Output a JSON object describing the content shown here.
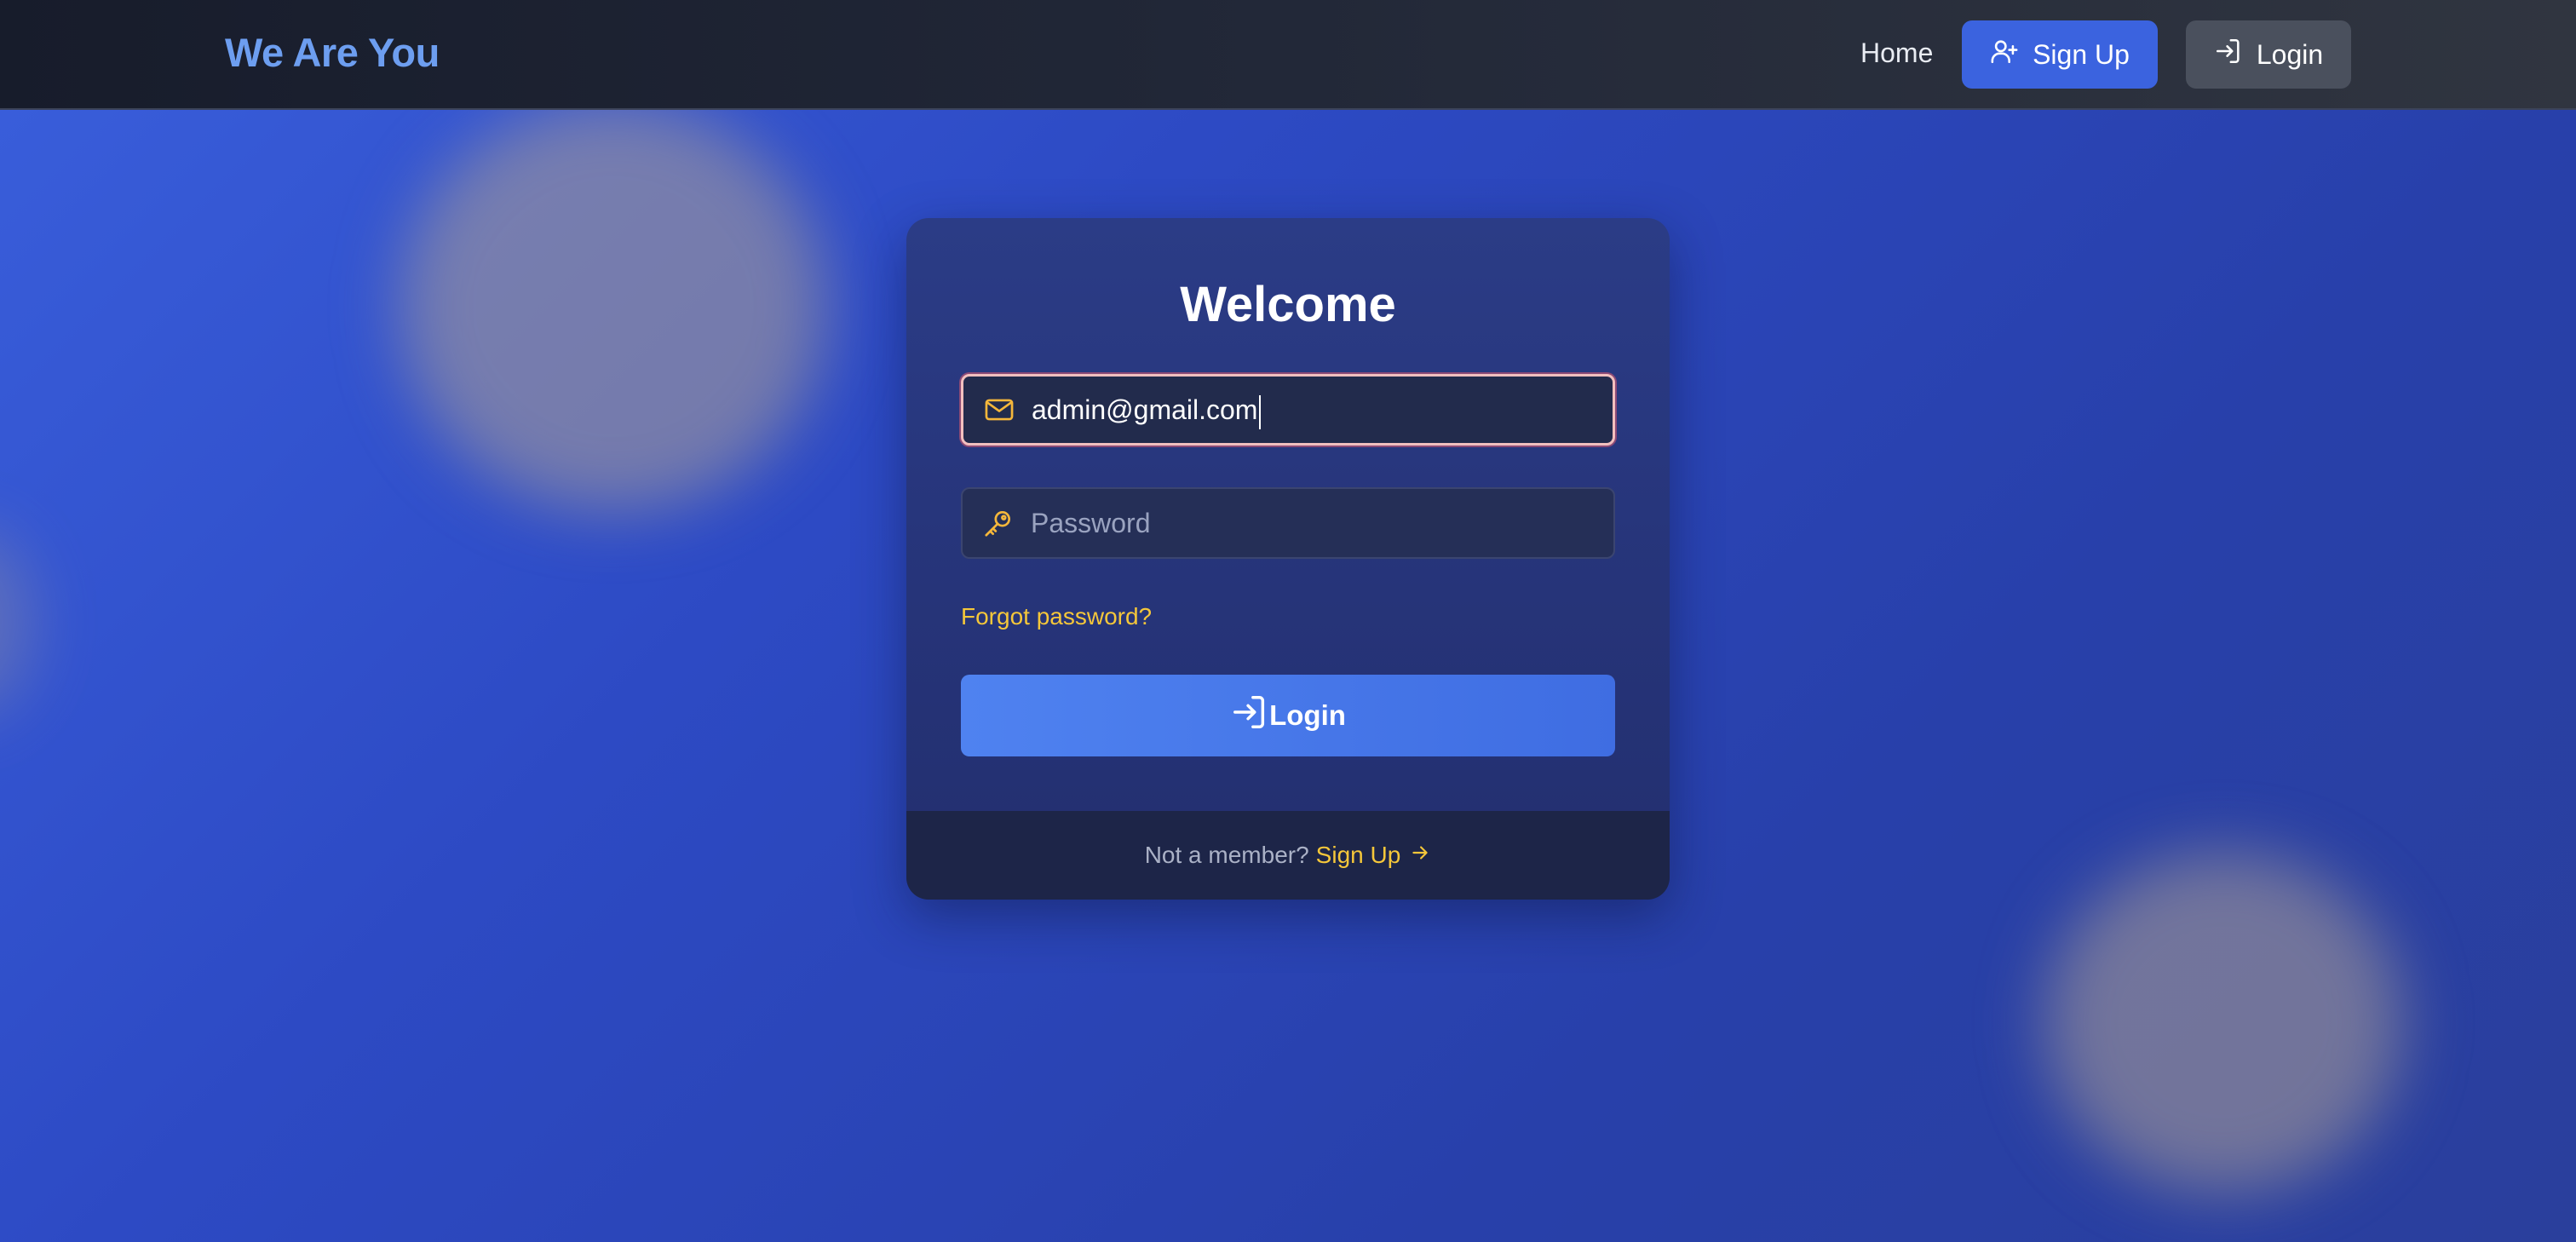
{
  "header": {
    "brand": "We Are You",
    "nav": {
      "home_label": "Home",
      "signup_label": "Sign Up",
      "login_label": "Login"
    }
  },
  "card": {
    "title": "Welcome",
    "email": {
      "value": "admin@gmail.com",
      "icon": "mail-icon"
    },
    "password": {
      "placeholder": "Password",
      "icon": "key-icon"
    },
    "forgot_label": "Forgot password?",
    "login_button_label": "Login",
    "footer": {
      "text": "Not a member?",
      "link_label": "Sign Up"
    }
  },
  "colors": {
    "accent": "#3b63df",
    "link": "#f5c73a",
    "brand": "#6d9ef0"
  }
}
